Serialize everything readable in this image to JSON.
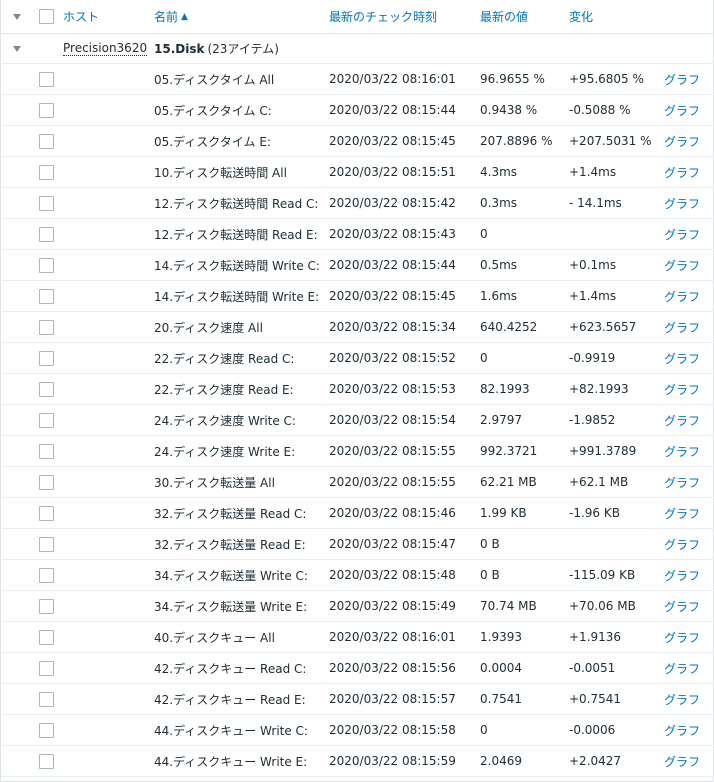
{
  "header": {
    "host": "ホスト",
    "name": "名前",
    "sort_indicator": "▲",
    "last_check": "最新のチェック時刻",
    "last_value": "最新の値",
    "change": "変化"
  },
  "group": {
    "host": "Precision3620",
    "application": "15.Disk",
    "count": "(23アイテム)"
  },
  "graph_label": "グラフ",
  "icons": {
    "collapse": "triangle-down-icon"
  },
  "colors": {
    "link": "#0275b8",
    "text": "#1f2c33",
    "border": "#ebeef0"
  },
  "items": [
    {
      "name": "05.ディスクタイム All",
      "time": "2020/03/22 08:16:01",
      "value": "96.9655 %",
      "change": "+95.6805 %"
    },
    {
      "name": "05.ディスクタイム C:",
      "time": "2020/03/22 08:15:44",
      "value": "0.9438 %",
      "change": "-0.5088 %"
    },
    {
      "name": "05.ディスクタイム E:",
      "time": "2020/03/22 08:15:45",
      "value": "207.8896 %",
      "change": "+207.5031 %"
    },
    {
      "name": "10.ディスク転送時間 All",
      "time": "2020/03/22 08:15:51",
      "value": "4.3ms",
      "change": "+1.4ms"
    },
    {
      "name": "12.ディスク転送時間 Read C:",
      "time": "2020/03/22 08:15:42",
      "value": "0.3ms",
      "change": "- 14.1ms"
    },
    {
      "name": "12.ディスク転送時間 Read E:",
      "time": "2020/03/22 08:15:43",
      "value": "0",
      "change": ""
    },
    {
      "name": "14.ディスク転送時間 Write C:",
      "time": "2020/03/22 08:15:44",
      "value": "0.5ms",
      "change": "+0.1ms"
    },
    {
      "name": "14.ディスク転送時間 Write E:",
      "time": "2020/03/22 08:15:45",
      "value": "1.6ms",
      "change": "+1.4ms"
    },
    {
      "name": "20.ディスク速度 All",
      "time": "2020/03/22 08:15:34",
      "value": "640.4252",
      "change": "+623.5657"
    },
    {
      "name": "22.ディスク速度 Read C:",
      "time": "2020/03/22 08:15:52",
      "value": "0",
      "change": "-0.9919"
    },
    {
      "name": "22.ディスク速度 Read E:",
      "time": "2020/03/22 08:15:53",
      "value": "82.1993",
      "change": "+82.1993"
    },
    {
      "name": "24.ディスク速度 Write C:",
      "time": "2020/03/22 08:15:54",
      "value": "2.9797",
      "change": "-1.9852"
    },
    {
      "name": "24.ディスク速度 Write E:",
      "time": "2020/03/22 08:15:55",
      "value": "992.3721",
      "change": "+991.3789"
    },
    {
      "name": "30.ディスク転送量 All",
      "time": "2020/03/22 08:15:55",
      "value": "62.21 MB",
      "change": "+62.1 MB"
    },
    {
      "name": "32.ディスク転送量 Read C:",
      "time": "2020/03/22 08:15:46",
      "value": "1.99 KB",
      "change": "-1.96 KB"
    },
    {
      "name": "32.ディスク転送量 Read E:",
      "time": "2020/03/22 08:15:47",
      "value": "0 B",
      "change": ""
    },
    {
      "name": "34.ディスク転送量 Write C:",
      "time": "2020/03/22 08:15:48",
      "value": "0 B",
      "change": "-115.09 KB"
    },
    {
      "name": "34.ディスク転送量 Write E:",
      "time": "2020/03/22 08:15:49",
      "value": "70.74 MB",
      "change": "+70.06 MB"
    },
    {
      "name": "40.ディスクキュー All",
      "time": "2020/03/22 08:16:01",
      "value": "1.9393",
      "change": "+1.9136"
    },
    {
      "name": "42.ディスクキュー Read C:",
      "time": "2020/03/22 08:15:56",
      "value": "0.0004",
      "change": "-0.0051"
    },
    {
      "name": "42.ディスクキュー Read E:",
      "time": "2020/03/22 08:15:57",
      "value": "0.7541",
      "change": "+0.7541"
    },
    {
      "name": "44.ディスクキュー Write C:",
      "time": "2020/03/22 08:15:58",
      "value": "0",
      "change": "-0.0006"
    },
    {
      "name": "44.ディスクキュー Write E:",
      "time": "2020/03/22 08:15:59",
      "value": "2.0469",
      "change": "+2.0427"
    }
  ]
}
